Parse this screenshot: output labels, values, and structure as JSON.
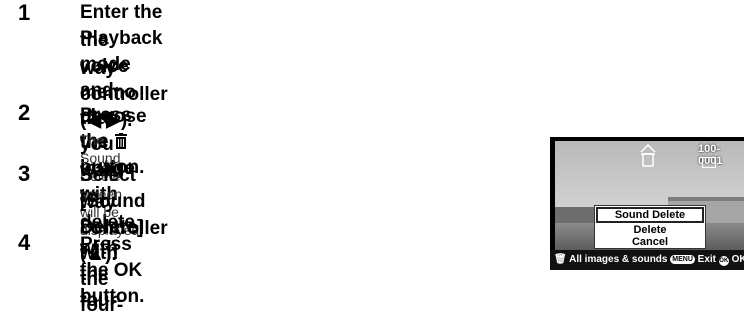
{
  "steps": [
    {
      "number": "1",
      "lines": [
        "Enter the Playback mode and choose the image with",
        "the voice memo that you want to delete with the four-",
        "way controller (◀ ▶)."
      ]
    },
    {
      "number": "2",
      "pre": "Press the",
      "post": "button.",
      "note": "The Sound Delete screen will be displayed."
    },
    {
      "number": "3",
      "lines": [
        "Select [Sound Delete] with the four-",
        "way controller (▲)."
      ]
    },
    {
      "number": "4",
      "lines": [
        "Press the OK button."
      ]
    }
  ],
  "camera_screen": {
    "folder_number": "100-0001",
    "menu_items": [
      "Sound Delete",
      "Delete",
      "Cancel"
    ],
    "bottom_bar": {
      "all_label": "All images & sounds",
      "menu_key": "MENU",
      "exit_label": "Exit",
      "ok_key": "OK",
      "ok_label": "OK"
    }
  },
  "icons": [
    "trash-icon",
    "voice-memo-icon",
    "delete-icon"
  ]
}
